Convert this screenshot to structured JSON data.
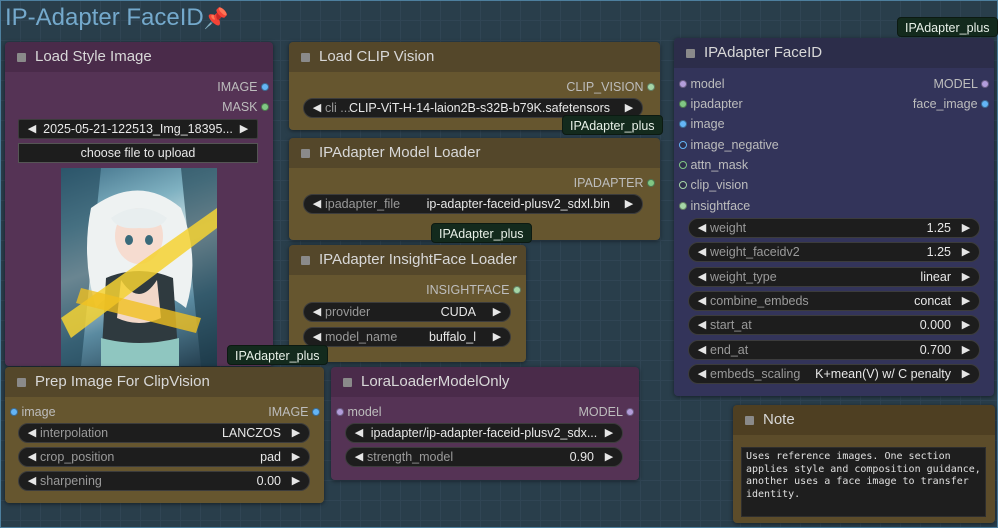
{
  "group": {
    "title": "IP-Adapter FaceID",
    "pin_icon": "📌"
  },
  "badges": {
    "text": "IPAdapter_plus"
  },
  "load_style": {
    "title": "Load Style Image",
    "outputs": [
      "IMAGE",
      "MASK"
    ],
    "image_value": "2025-05-21-122513_Img_18395...",
    "upload_label": "choose file to upload"
  },
  "clip_vision": {
    "title": "Load CLIP Vision",
    "output": "CLIP_VISION",
    "widget_label": "cli ...",
    "widget_value": "CLIP-ViT-H-14-laion2B-s32B-b79K.safetensors"
  },
  "model_loader": {
    "title": "IPAdapter Model Loader",
    "output": "IPADAPTER",
    "widget_label": "ipadapter_file",
    "widget_value": "ip-adapter-faceid-plusv2_sdxl.bin"
  },
  "insightface": {
    "title": "IPAdapter InsightFace Loader",
    "output": "INSIGHTFACE",
    "provider_label": "provider",
    "provider_value": "CUDA",
    "model_label": "model_name",
    "model_value": "buffalo_l"
  },
  "faceid": {
    "title": "IPAdapter FaceID",
    "inputs": [
      "model",
      "ipadapter",
      "image",
      "image_negative",
      "attn_mask",
      "clip_vision",
      "insightface"
    ],
    "outputs": [
      "MODEL",
      "face_image"
    ],
    "widgets": [
      {
        "label": "weight",
        "value": "1.25"
      },
      {
        "label": "weight_faceidv2",
        "value": "1.25"
      },
      {
        "label": "weight_type",
        "value": "linear"
      },
      {
        "label": "combine_embeds",
        "value": "concat"
      },
      {
        "label": "start_at",
        "value": "0.000"
      },
      {
        "label": "end_at",
        "value": "0.700"
      },
      {
        "label": "embeds_scaling",
        "value": "K+mean(V) w/ C penalty"
      }
    ]
  },
  "prep_image": {
    "title": "Prep Image For ClipVision",
    "input": "image",
    "output": "IMAGE",
    "widgets": [
      {
        "label": "interpolation",
        "value": "LANCZOS"
      },
      {
        "label": "crop_position",
        "value": "pad"
      },
      {
        "label": "sharpening",
        "value": "0.00"
      }
    ]
  },
  "lora": {
    "title": "LoraLoaderModelOnly",
    "input": "model",
    "output": "MODEL",
    "lora_value": "ipadapter/ip-adapter-faceid-plusv2_sdx...",
    "strength_label": "strength_model",
    "strength_value": "0.90"
  },
  "note": {
    "title": "Note",
    "text": "Uses reference images. One section applies style and composition guidance, another uses a face image to transfer identity."
  },
  "colors": {
    "image_slot": "#64b5f6",
    "mask_slot": "#81c784",
    "model_slot": "#b39ddb",
    "clip_vision_slot": "#a5d6a7",
    "insightface_slot": "#a5d6a7"
  }
}
